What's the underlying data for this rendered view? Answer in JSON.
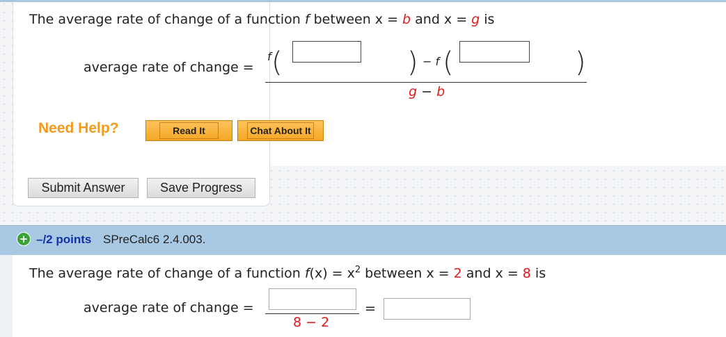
{
  "q1": {
    "intro": {
      "t1": "The average rate of change of a function ",
      "f": "f",
      "t2": " between  x = ",
      "b": "b",
      "t3": "  and  x = ",
      "g": "g",
      "t4": "  is"
    },
    "label": "average rate of change =",
    "f1": "f",
    "minus_f": "− f",
    "open": "(",
    "close": ")",
    "den_g": "g",
    "den_minus": " − ",
    "den_b": "b"
  },
  "help": {
    "label": "Need Help?",
    "read_it": "Read It",
    "chat": "Chat About It"
  },
  "actions": {
    "submit": "Submit Answer",
    "save": "Save Progress"
  },
  "q2_header": {
    "points": "–/2 points",
    "id": "SPreCalc6 2.4.003."
  },
  "q2": {
    "t1": "The average rate of change of a function ",
    "fx": "f",
    "t1b": "(x) = x",
    "sup": "2",
    "t2": "  between  x = ",
    "a": "2",
    "t3": "  and  x = ",
    "b": "8",
    "t4": "  is",
    "label": "average rate of change =",
    "den": "8 − 2",
    "eq": "="
  }
}
